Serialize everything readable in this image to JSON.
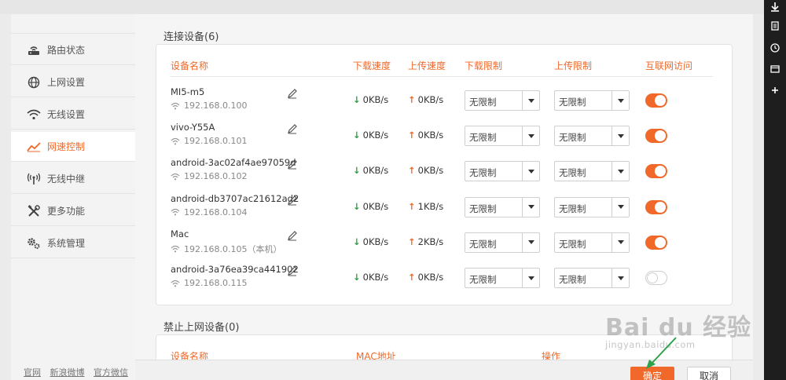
{
  "sidebar": {
    "items": [
      {
        "label": "路由状态",
        "icon": "router-icon"
      },
      {
        "label": "上网设置",
        "icon": "globe-icon"
      },
      {
        "label": "无线设置",
        "icon": "wifi-icon"
      },
      {
        "label": "网速控制",
        "icon": "speed-chart-icon",
        "active": true
      },
      {
        "label": "无线中继",
        "icon": "antenna-icon"
      },
      {
        "label": "更多功能",
        "icon": "tools-icon"
      },
      {
        "label": "系统管理",
        "icon": "gears-icon"
      }
    ],
    "footer_links": [
      "官网",
      "新浪微博",
      "官方微信"
    ]
  },
  "connected": {
    "title": "连接设备(6)",
    "headers": {
      "name": "设备名称",
      "down_speed": "下载速度",
      "up_speed": "上传速度",
      "down_limit": "下载限制",
      "up_limit": "上传限制",
      "internet": "互联网访问"
    },
    "devices": [
      {
        "name": "MI5-m5",
        "ip": "192.168.0.100",
        "down": "0KB/s",
        "up": "0KB/s",
        "down_limit": "无限制",
        "up_limit": "无限制",
        "internet": true
      },
      {
        "name": "vivo-Y55A",
        "ip": "192.168.0.101",
        "down": "0KB/s",
        "up": "0KB/s",
        "down_limit": "无限制",
        "up_limit": "无限制",
        "internet": true
      },
      {
        "name": "android-3ac02af4ae97059d",
        "ip": "192.168.0.102",
        "down": "0KB/s",
        "up": "0KB/s",
        "down_limit": "无限制",
        "up_limit": "无限制",
        "internet": true
      },
      {
        "name": "android-db3707ac21612ad2",
        "ip": "192.168.0.104",
        "down": "0KB/s",
        "up": "1KB/s",
        "down_limit": "无限制",
        "up_limit": "无限制",
        "internet": true
      },
      {
        "name": "Mac",
        "ip": "192.168.0.105（本机）",
        "down": "0KB/s",
        "up": "2KB/s",
        "down_limit": "无限制",
        "up_limit": "无限制",
        "internet": true
      },
      {
        "name": "android-3a76ea39ca441902",
        "ip": "192.168.0.115",
        "down": "0KB/s",
        "up": "0KB/s",
        "down_limit": "无限制",
        "up_limit": "无限制",
        "internet": false
      }
    ]
  },
  "blocked": {
    "title": "禁止上网设备(0)",
    "headers": {
      "name": "设备名称",
      "mac": "MAC地址",
      "action": "操作"
    }
  },
  "actions": {
    "ok": "确定",
    "cancel": "取消"
  },
  "watermark": {
    "main": "Bai du 经验",
    "sub": "jingyan.baidu.com"
  },
  "colors": {
    "accent": "#f0692a",
    "download_arrow": "#2da24a",
    "upload_arrow": "#f0692a"
  },
  "right_toolbar": [
    "download-icon",
    "document-icon",
    "clock-icon",
    "window-icon",
    "plus-icon"
  ]
}
